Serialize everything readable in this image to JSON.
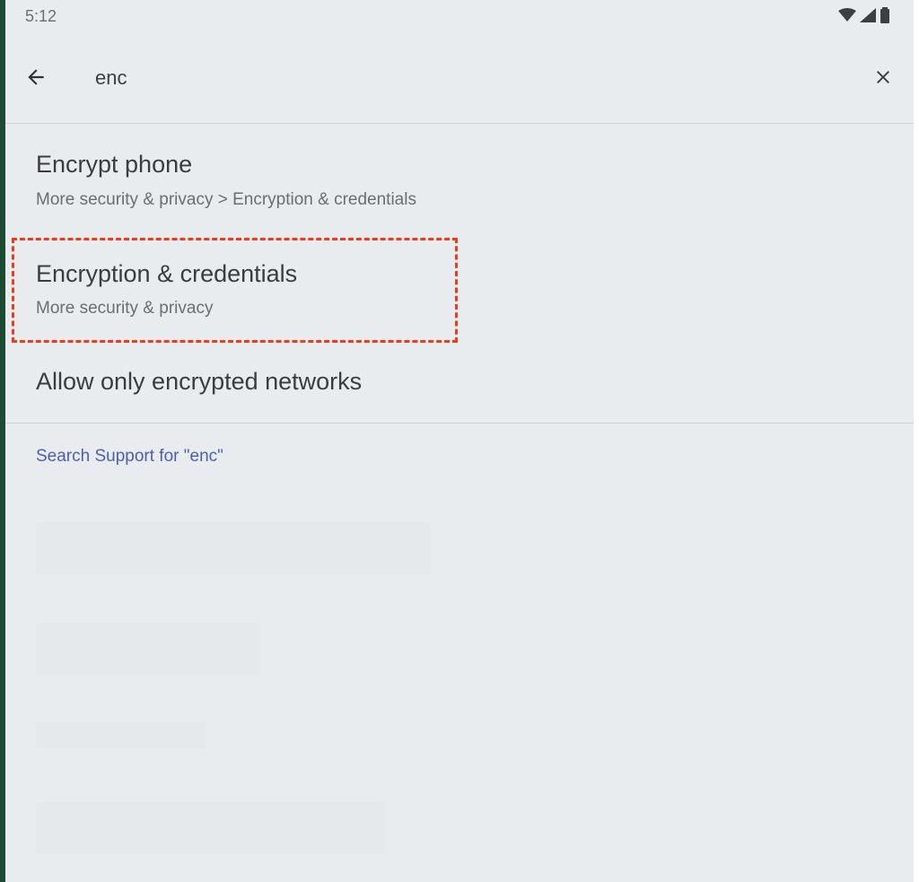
{
  "status_bar": {
    "time": "5:12",
    "icons": [
      "wifi-icon",
      "signal-icon",
      "battery-icon"
    ]
  },
  "search": {
    "query": "enc",
    "back_icon": "arrow-back-icon",
    "clear_icon": "close-icon"
  },
  "results": [
    {
      "title": "Encrypt phone",
      "subtitle": "More security & privacy > Encryption & credentials"
    },
    {
      "title": "Encryption & credentials",
      "subtitle": "More security & privacy",
      "highlighted": true
    },
    {
      "title": "Allow only encrypted networks"
    }
  ],
  "support": {
    "label": "Search Support for \"enc\""
  },
  "colors": {
    "background": "#e9ecef",
    "highlight": "#f03a1e",
    "link": "#4d5fa8"
  }
}
